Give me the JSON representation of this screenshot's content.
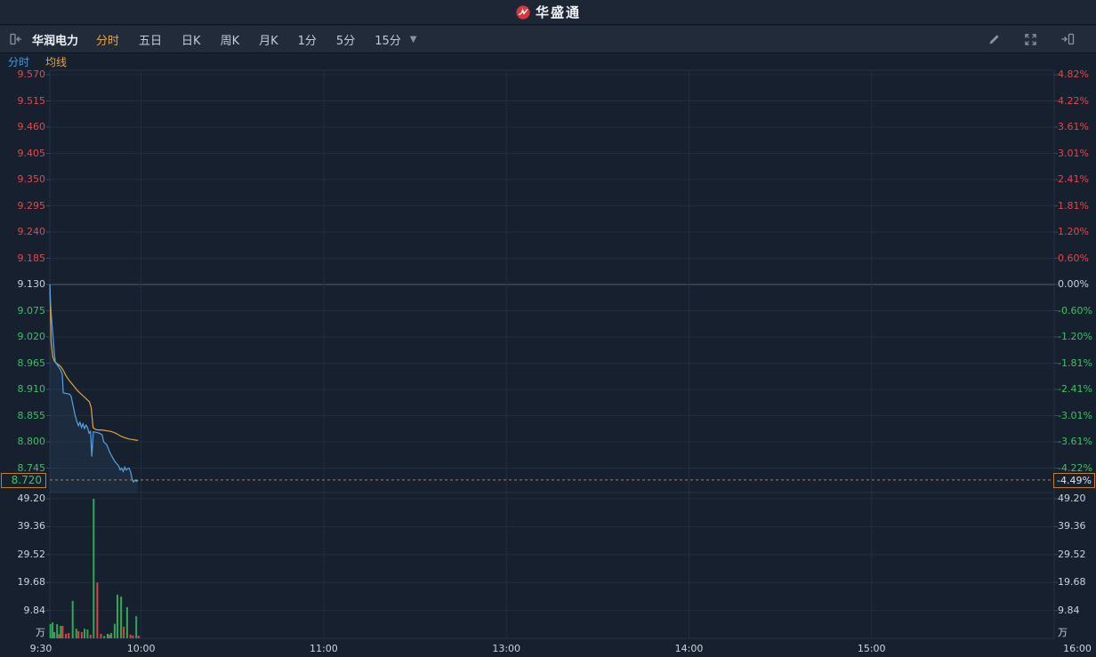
{
  "app": {
    "title": "华盛通"
  },
  "toolbar": {
    "stock_name": "华润电力",
    "periods": [
      {
        "label": "分时",
        "active": true
      },
      {
        "label": "五日",
        "active": false
      },
      {
        "label": "日K",
        "active": false
      },
      {
        "label": "周K",
        "active": false
      },
      {
        "label": "月K",
        "active": false
      },
      {
        "label": "1分",
        "active": false
      },
      {
        "label": "5分",
        "active": false
      },
      {
        "label": "15分",
        "active": false
      }
    ]
  },
  "legend": {
    "items": [
      {
        "label": "分时",
        "color": "#4e96dd"
      },
      {
        "label": "均线",
        "color": "#e8a33d"
      }
    ]
  },
  "colors": {
    "up_text": "#e2484f",
    "down_text": "#3cc065",
    "neutral_text": "#c9d2dc",
    "price_line": "#5d9fe2",
    "avg_line": "#e0a33c",
    "vol_up": "#2cab55",
    "vol_down": "#df4044",
    "grid": "#222e3f",
    "grid_strong": "#4d5d75",
    "pane_border": "#26334a",
    "highlight": "#bf7f2f"
  },
  "chart_data": {
    "type": "line",
    "title": "华润电力 分时图",
    "prev_close": 9.13,
    "last_price_label": "8.720",
    "last_change_pct_label": "-4.49%",
    "price_axis_labels": [
      "9.570",
      "9.515",
      "9.460",
      "9.405",
      "9.350",
      "9.295",
      "9.240",
      "9.185",
      "9.130",
      "9.075",
      "9.020",
      "8.965",
      "8.910",
      "8.855",
      "8.800",
      "8.745"
    ],
    "pct_axis_labels": [
      "4.82%",
      "4.22%",
      "3.61%",
      "3.01%",
      "2.41%",
      "1.81%",
      "1.20%",
      "0.60%",
      "0.00%",
      "-0.60%",
      "-1.20%",
      "-1.81%",
      "-2.41%",
      "-3.01%",
      "-3.61%",
      "-4.22%"
    ],
    "volume_axis_labels": [
      "49.20",
      "39.36",
      "29.52",
      "19.68",
      "9.84"
    ],
    "volume_unit": "万",
    "volume_max": 49.2,
    "time_axis": {
      "labels": [
        "9:30",
        "10:00",
        "11:00",
        "13:00",
        "14:00",
        "15:00",
        "16:00"
      ],
      "minutes": [
        0,
        30,
        90,
        150,
        210,
        270,
        330
      ],
      "total_minutes": 330
    },
    "series": [
      {
        "name": "分时",
        "points": [
          [
            0,
            9.13
          ],
          [
            0.3,
            9.085
          ],
          [
            0.7,
            9.048
          ],
          [
            1.1,
            9.017
          ],
          [
            1.5,
            8.985
          ],
          [
            1.8,
            8.967
          ],
          [
            2.6,
            8.96
          ],
          [
            3.5,
            8.951
          ],
          [
            4.1,
            8.942
          ],
          [
            4.4,
            8.903
          ],
          [
            6.5,
            8.9
          ],
          [
            7.0,
            8.896
          ],
          [
            7.5,
            8.88
          ],
          [
            8.3,
            8.856
          ],
          [
            9.0,
            8.841
          ],
          [
            9.4,
            8.834
          ],
          [
            9.9,
            8.841
          ],
          [
            10.4,
            8.83
          ],
          [
            10.9,
            8.838
          ],
          [
            11.4,
            8.828
          ],
          [
            11.9,
            8.835
          ],
          [
            12.4,
            8.83
          ],
          [
            12.9,
            8.818
          ],
          [
            13.4,
            8.822
          ],
          [
            13.8,
            8.769
          ],
          [
            14.3,
            8.821
          ],
          [
            15.3,
            8.82
          ],
          [
            16.3,
            8.818
          ],
          [
            17.2,
            8.815
          ],
          [
            17.7,
            8.8
          ],
          [
            18.7,
            8.794
          ],
          [
            19.7,
            8.778
          ],
          [
            20.7,
            8.766
          ],
          [
            21.6,
            8.757
          ],
          [
            22.6,
            8.75
          ],
          [
            23.1,
            8.741
          ],
          [
            23.6,
            8.745
          ],
          [
            24.1,
            8.738
          ],
          [
            24.6,
            8.747
          ],
          [
            25.1,
            8.741
          ],
          [
            25.6,
            8.744
          ],
          [
            26.0,
            8.745
          ],
          [
            26.5,
            8.738
          ],
          [
            27.0,
            8.722
          ],
          [
            27.5,
            8.716
          ],
          [
            28.0,
            8.72
          ],
          [
            28.5,
            8.717
          ],
          [
            29.0,
            8.72
          ]
        ]
      },
      {
        "name": "均线",
        "points": [
          [
            0,
            9.13
          ],
          [
            0.4,
            9.01
          ],
          [
            1.0,
            8.978
          ],
          [
            1.6,
            8.968
          ],
          [
            2.6,
            8.963
          ],
          [
            3.6,
            8.958
          ],
          [
            4.4,
            8.95
          ],
          [
            5.2,
            8.94
          ],
          [
            6.0,
            8.932
          ],
          [
            7.0,
            8.924
          ],
          [
            8.0,
            8.916
          ],
          [
            9.0,
            8.908
          ],
          [
            10.0,
            8.902
          ],
          [
            11.0,
            8.896
          ],
          [
            12.0,
            8.89
          ],
          [
            13.0,
            8.884
          ],
          [
            13.6,
            8.872
          ],
          [
            14.2,
            8.83
          ],
          [
            15.0,
            8.826
          ],
          [
            16.0,
            8.825
          ],
          [
            17.0,
            8.825
          ],
          [
            18.0,
            8.824
          ],
          [
            19.0,
            8.823
          ],
          [
            20.0,
            8.822
          ],
          [
            21.0,
            8.82
          ],
          [
            22.0,
            8.817
          ],
          [
            23.0,
            8.813
          ],
          [
            24.0,
            8.81
          ],
          [
            25.0,
            8.808
          ],
          [
            26.0,
            8.806
          ],
          [
            27.0,
            8.805
          ],
          [
            28.0,
            8.804
          ],
          [
            29.0,
            8.803
          ]
        ]
      }
    ],
    "volume_bars": [
      [
        0.2,
        5.0,
        "u"
      ],
      [
        0.9,
        5.6,
        "u"
      ],
      [
        1.5,
        2.2,
        "u"
      ],
      [
        2.4,
        5.0,
        "u"
      ],
      [
        3.0,
        1.5,
        "d"
      ],
      [
        3.6,
        4.4,
        "u"
      ],
      [
        4.2,
        4.4,
        "d"
      ],
      [
        5.3,
        1.6,
        "d"
      ],
      [
        6.2,
        1.9,
        "d"
      ],
      [
        7.5,
        13.2,
        "u"
      ],
      [
        8.7,
        3.4,
        "u"
      ],
      [
        9.4,
        2.5,
        "d"
      ],
      [
        10.5,
        2.2,
        "d"
      ],
      [
        11.4,
        3.4,
        "u"
      ],
      [
        12.4,
        3.1,
        "u"
      ],
      [
        13.4,
        1.3,
        "d"
      ],
      [
        14.4,
        49.2,
        "u"
      ],
      [
        15.6,
        19.7,
        "d"
      ],
      [
        16.8,
        1.6,
        "d"
      ],
      [
        17.9,
        0.8,
        "u"
      ],
      [
        19.0,
        1.6,
        "u"
      ],
      [
        19.6,
        1.3,
        "d"
      ],
      [
        20.2,
        1.9,
        "u"
      ],
      [
        21.3,
        5.1,
        "u"
      ],
      [
        22.2,
        15.4,
        "u"
      ],
      [
        23.4,
        14.7,
        "u"
      ],
      [
        24.3,
        4.1,
        "d"
      ],
      [
        25.4,
        11.0,
        "u"
      ],
      [
        26.5,
        1.3,
        "d"
      ],
      [
        27.3,
        1.0,
        "d"
      ],
      [
        28.4,
        7.8,
        "u"
      ],
      [
        29.2,
        0.9,
        "d"
      ]
    ]
  }
}
